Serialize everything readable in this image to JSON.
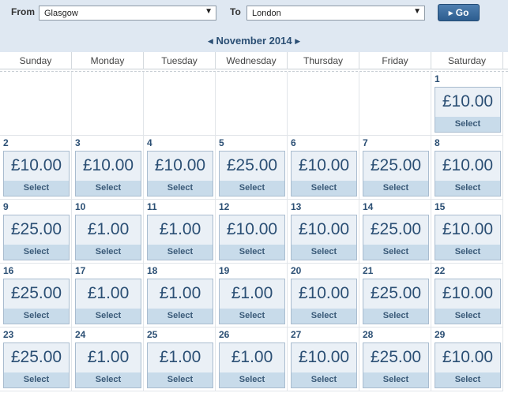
{
  "search": {
    "from_label": "From",
    "from_value": "Glasgow",
    "to_label": "To",
    "to_value": "London",
    "go_label": "Go"
  },
  "calendar": {
    "month_title": "November 2014",
    "weekdays": [
      "Sunday",
      "Monday",
      "Tuesday",
      "Wednesday",
      "Thursday",
      "Friday",
      "Saturday"
    ],
    "select_label": "Select",
    "days": [
      {
        "day": "1",
        "price": "£10.00"
      },
      {
        "day": "2",
        "price": "£10.00"
      },
      {
        "day": "3",
        "price": "£10.00"
      },
      {
        "day": "4",
        "price": "£10.00"
      },
      {
        "day": "5",
        "price": "£25.00"
      },
      {
        "day": "6",
        "price": "£10.00"
      },
      {
        "day": "7",
        "price": "£25.00"
      },
      {
        "day": "8",
        "price": "£10.00"
      },
      {
        "day": "9",
        "price": "£25.00"
      },
      {
        "day": "10",
        "price": "£1.00"
      },
      {
        "day": "11",
        "price": "£1.00"
      },
      {
        "day": "12",
        "price": "£10.00"
      },
      {
        "day": "13",
        "price": "£10.00"
      },
      {
        "day": "14",
        "price": "£25.00"
      },
      {
        "day": "15",
        "price": "£10.00"
      },
      {
        "day": "16",
        "price": "£25.00"
      },
      {
        "day": "17",
        "price": "£1.00"
      },
      {
        "day": "18",
        "price": "£1.00"
      },
      {
        "day": "19",
        "price": "£1.00"
      },
      {
        "day": "20",
        "price": "£10.00"
      },
      {
        "day": "21",
        "price": "£25.00"
      },
      {
        "day": "22",
        "price": "£10.00"
      },
      {
        "day": "23",
        "price": "£25.00"
      },
      {
        "day": "24",
        "price": "£1.00"
      },
      {
        "day": "25",
        "price": "£1.00"
      },
      {
        "day": "26",
        "price": "£1.00"
      },
      {
        "day": "27",
        "price": "£10.00"
      },
      {
        "day": "28",
        "price": "£25.00"
      },
      {
        "day": "29",
        "price": "£10.00"
      }
    ]
  },
  "colors": {
    "header_bg": "#dfe8f2",
    "accent": "#2b4f74",
    "go_button": "#3a6a9c",
    "select_strip": "#c8dbea"
  }
}
